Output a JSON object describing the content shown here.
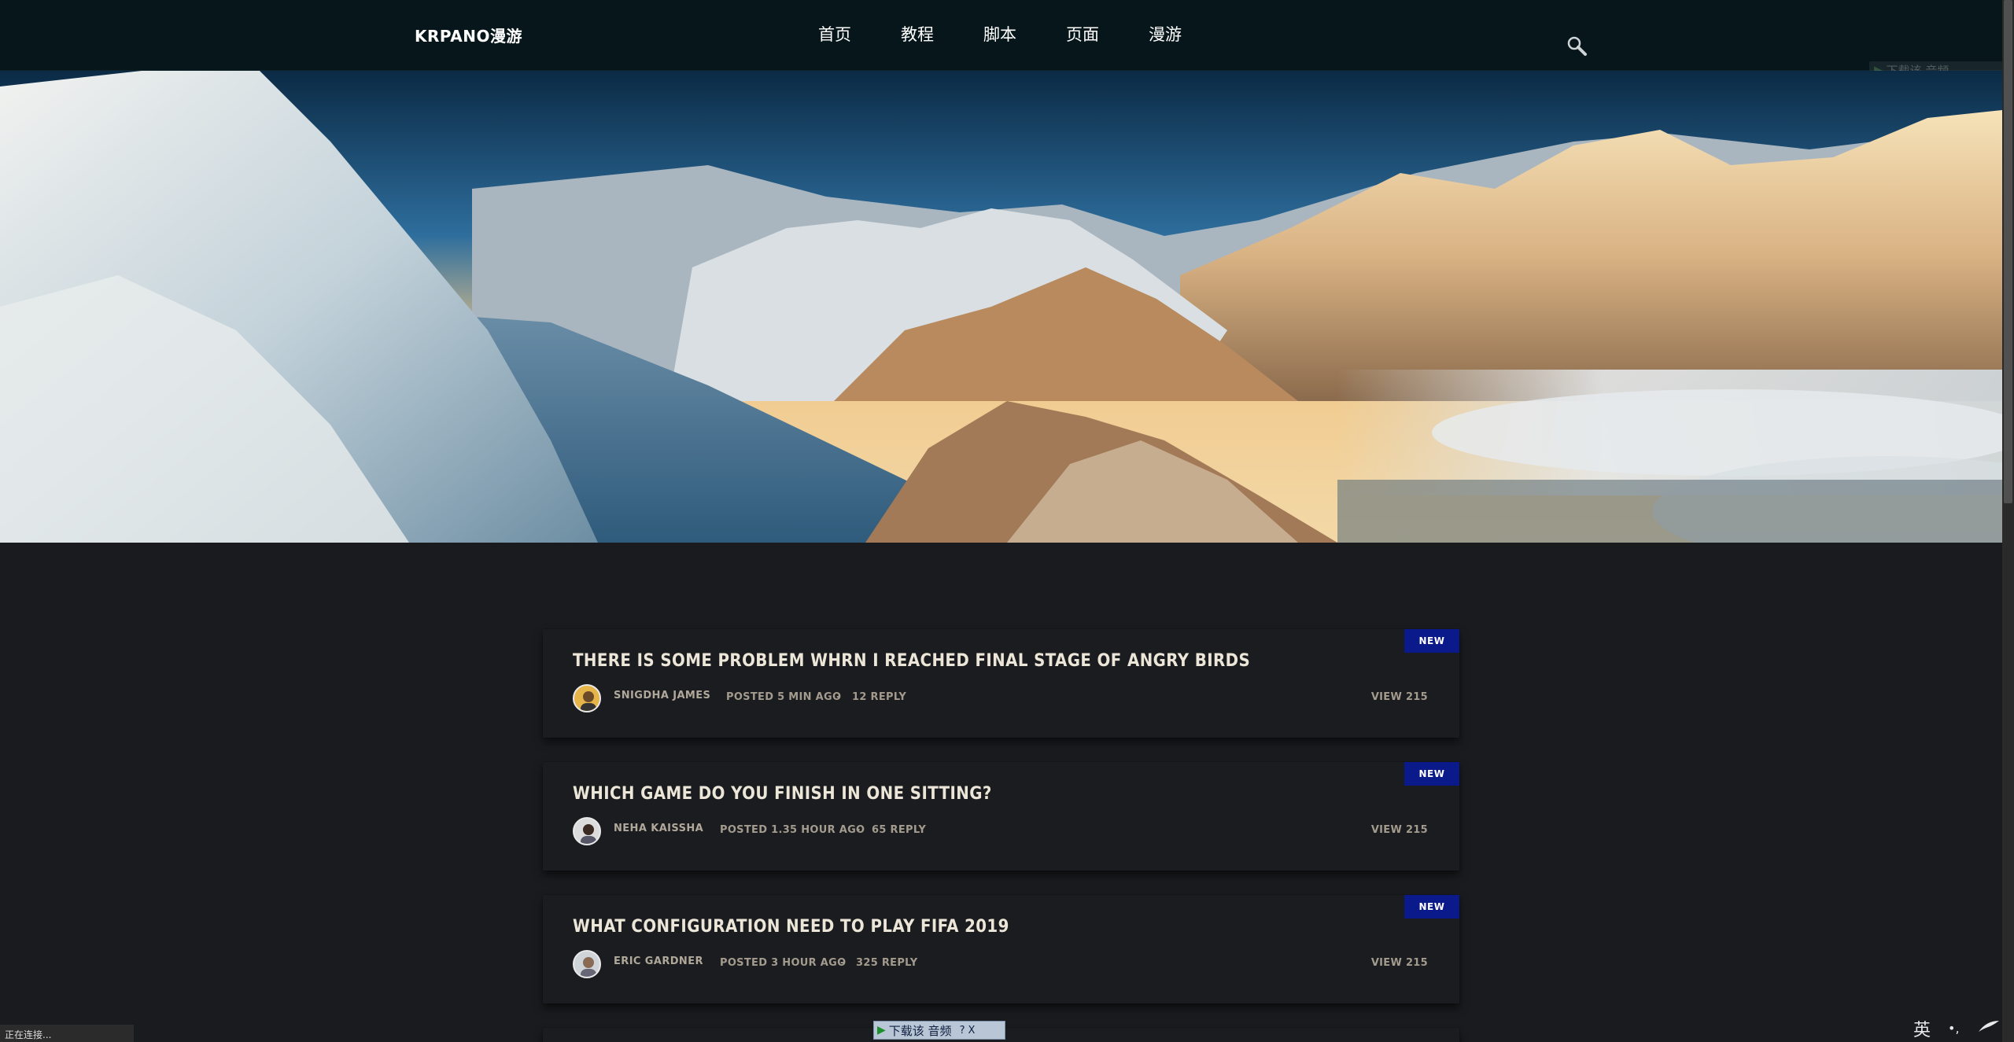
{
  "header": {
    "logo": "KRPANO漫游",
    "nav": [
      "首页",
      "教程",
      "脚本",
      "页面",
      "漫游"
    ],
    "download_bar_label": "下载该 音频"
  },
  "posts": [
    {
      "badge": "NEW",
      "title": "THERE IS SOME PROBLEM WHRN I REACHED FINAL STAGE OF ANGRY BIRDS",
      "author": "SNIGDHA JAMES",
      "posted": "POSTED 5 MIN AGO",
      "separator": "-",
      "replies": "12 REPLY",
      "views": "VIEW 215"
    },
    {
      "badge": "NEW",
      "title": "WHICH GAME DO YOU FINISH IN ONE SITTING?",
      "author": "NEHA KAISSHA",
      "posted": "POSTED 1.35 HOUR AGO",
      "separator": "-",
      "replies": "65 REPLY",
      "views": "VIEW 215"
    },
    {
      "badge": "NEW",
      "title": "WHAT CONFIGURATION NEED TO PLAY FIFA 2019",
      "author": "ERIC GARDNER",
      "posted": "POSTED 3 HOUR AGO",
      "separator": "-",
      "replies": "325 REPLY",
      "views": "VIEW 215"
    }
  ],
  "status_bar": "正在连接...",
  "bottom_download_bar": {
    "label": "下载该 音频",
    "help": "?",
    "close": "X"
  },
  "ime": {
    "mode": "英",
    "punct": "•,"
  },
  "colors": {
    "header_bg": "#06161a",
    "page_bg": "#1a1b1e",
    "badge_bg": "#0b1a8a"
  }
}
